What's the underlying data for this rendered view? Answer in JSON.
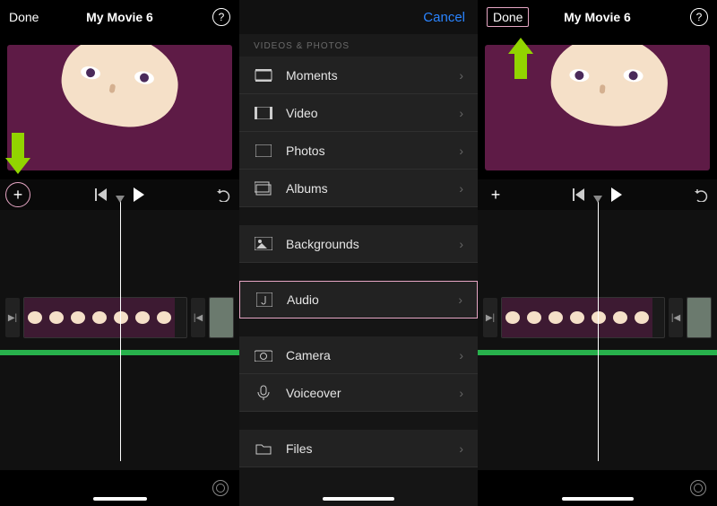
{
  "left": {
    "done": "Done",
    "title": "My Movie 6",
    "help": "?"
  },
  "menu": {
    "cancel": "Cancel",
    "section": "VIDEOS & PHOTOS",
    "items": [
      {
        "label": "Moments"
      },
      {
        "label": "Video"
      },
      {
        "label": "Photos"
      },
      {
        "label": "Albums"
      }
    ],
    "group2": [
      {
        "label": "Backgrounds"
      }
    ],
    "group3": [
      {
        "label": "Audio"
      }
    ],
    "group4": [
      {
        "label": "Camera"
      },
      {
        "label": "Voiceover"
      }
    ],
    "group5": [
      {
        "label": "Files"
      }
    ]
  },
  "right": {
    "done": "Done",
    "title": "My Movie 6",
    "help": "?"
  }
}
